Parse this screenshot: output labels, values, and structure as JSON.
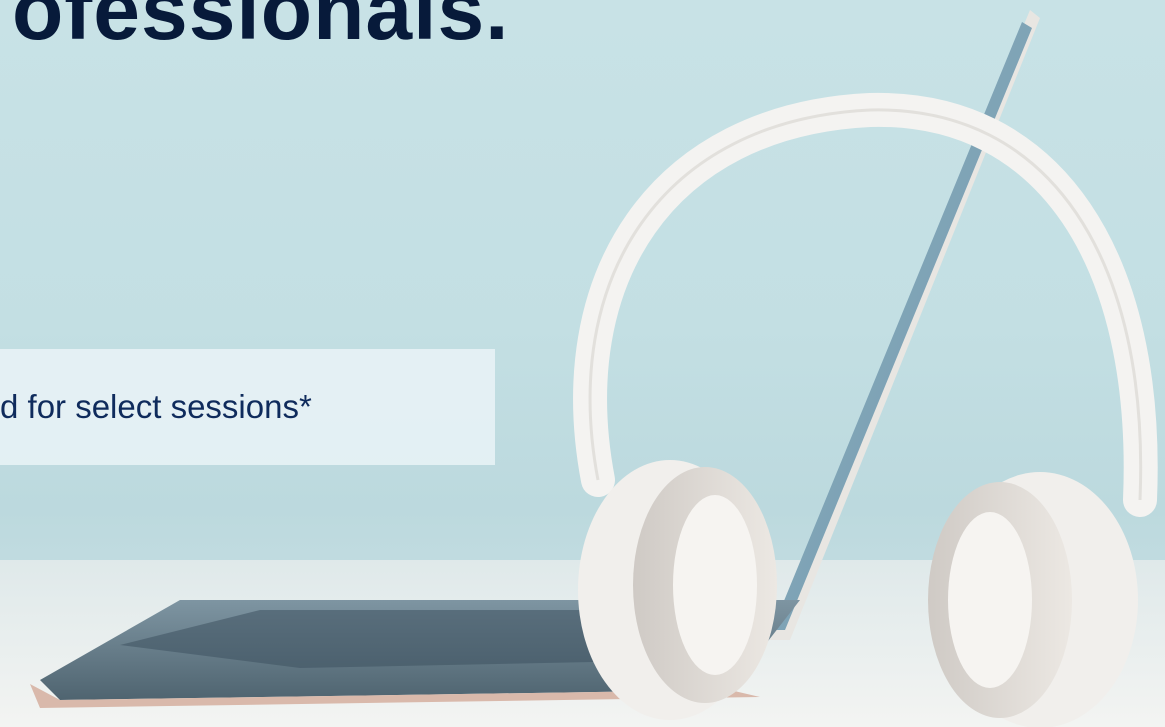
{
  "hero": {
    "headline": "ofessionals.",
    "note": "d for select sessions*"
  },
  "colors": {
    "headline": "#071a3a",
    "note_text": "#0f2b5c",
    "note_background": "#e8f2f6",
    "background": "#c5e0e4"
  },
  "icons": {
    "image": "laptop-with-headphones-photo"
  }
}
